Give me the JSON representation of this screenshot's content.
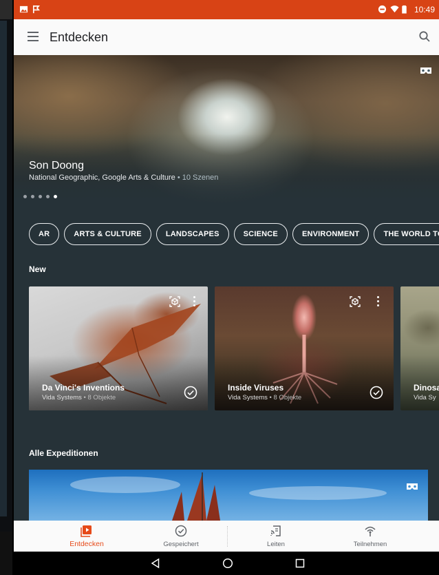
{
  "status_bar": {
    "time": "10:49",
    "left_icons": [
      "image-icon",
      "flag-icon"
    ],
    "right_icons": [
      "do-not-disturb-icon",
      "wifi-icon",
      "battery-icon"
    ]
  },
  "app_bar": {
    "title": "Entdecken",
    "menu_icon": "menu-icon",
    "search_icon": "search-icon"
  },
  "hero": {
    "title": "Son Doong",
    "subtitle_main": "National Geographic, Google Arts & Culture",
    "subtitle_meta": " • 10 Szenen",
    "dots_total": 5,
    "dots_active_index": 4,
    "badge_icon": "vr-headset-icon"
  },
  "categories": [
    "AR",
    "ARTS & CULTURE",
    "LANDSCAPES",
    "SCIENCE",
    "ENVIRONMENT",
    "THE WORLD TODAY"
  ],
  "new_section": {
    "heading": "New",
    "cards": [
      {
        "title": "Da Vinci's Inventions",
        "publisher": "Vida Systems",
        "meta": " • 8 Objekte",
        "badge_icon": "ar-icon"
      },
      {
        "title": "Inside Viruses",
        "publisher": "Vida Systems",
        "meta": " • 8 Objekte",
        "badge_icon": "ar-icon"
      },
      {
        "title": "Dinosa",
        "publisher": "Vida Sy",
        "meta": "",
        "badge_icon": ""
      }
    ]
  },
  "all_section": {
    "heading": "Alle Expeditionen",
    "badge_icon": "vr-headset-icon"
  },
  "bottom_nav": [
    {
      "label": "Entdecken",
      "icon": "explore-icon",
      "active": true
    },
    {
      "label": "Gespeichert",
      "icon": "saved-check-icon",
      "active": false
    },
    {
      "label": "Leiten",
      "icon": "cast-lead-icon",
      "active": false
    },
    {
      "label": "Teilnehmen",
      "icon": "join-broadcast-icon",
      "active": false
    }
  ],
  "colors": {
    "status_bar": "#d84315",
    "accent": "#e64a19",
    "background": "#263238",
    "app_bar": "#fafafa"
  }
}
